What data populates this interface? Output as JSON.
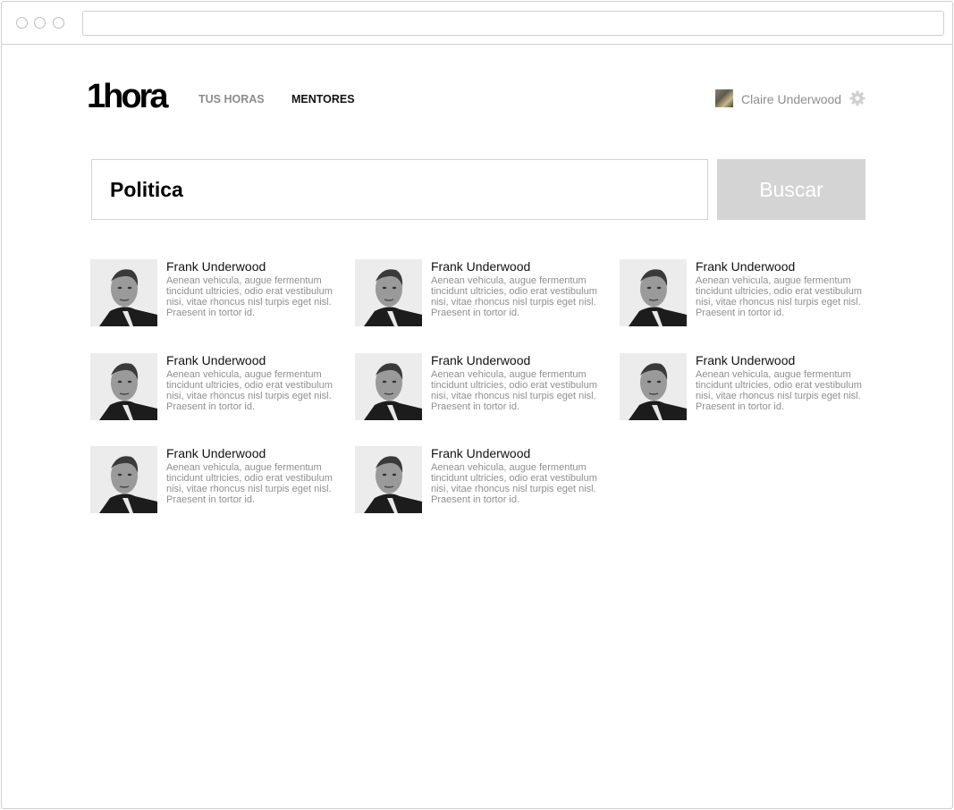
{
  "browser": {
    "url": ""
  },
  "header": {
    "logo": "1hora",
    "nav": [
      {
        "label": "TUS HORAS",
        "active": false
      },
      {
        "label": "MENTORES",
        "active": true
      }
    ],
    "user": {
      "name": "Claire Underwood"
    }
  },
  "search": {
    "value": "Politica",
    "button_label": "Buscar"
  },
  "mentors": [
    {
      "name": "Frank Underwood",
      "bio": "Aenean vehicula, augue fermentum tincidunt ultricies, odio erat vestibulum nisi, vitae rhoncus nisl turpis eget nisl. Praesent in tortor id."
    },
    {
      "name": "Frank Underwood",
      "bio": "Aenean vehicula, augue fermentum tincidunt ultricies, odio erat vestibulum nisi, vitae rhoncus nisl turpis eget nisl. Praesent in tortor id."
    },
    {
      "name": "Frank Underwood",
      "bio": "Aenean vehicula, augue fermentum tincidunt ultricies, odio erat vestibulum nisi, vitae rhoncus nisl turpis eget nisl. Praesent in tortor id."
    },
    {
      "name": "Frank Underwood",
      "bio": "Aenean vehicula, augue fermentum tincidunt ultricies, odio erat vestibulum nisi, vitae rhoncus nisl turpis eget nisl. Praesent in tortor id."
    },
    {
      "name": "Frank Underwood",
      "bio": "Aenean vehicula, augue fermentum tincidunt ultricies, odio erat vestibulum nisi, vitae rhoncus nisl turpis eget nisl. Praesent in tortor id."
    },
    {
      "name": "Frank Underwood",
      "bio": "Aenean vehicula, augue fermentum tincidunt ultricies, odio erat vestibulum nisi, vitae rhoncus nisl turpis eget nisl. Praesent in tortor id."
    },
    {
      "name": "Frank Underwood",
      "bio": "Aenean vehicula, augue fermentum tincidunt ultricies, odio erat vestibulum nisi, vitae rhoncus nisl turpis eget nisl. Praesent in tortor id."
    },
    {
      "name": "Frank Underwood",
      "bio": "Aenean vehicula, augue fermentum tincidunt ultricies, odio erat vestibulum nisi, vitae rhoncus nisl turpis eget nisl. Praesent in tortor id."
    }
  ],
  "icons": {
    "settings": "gear-icon",
    "avatar": "user-avatar"
  },
  "colors": {
    "button_bg": "#d4d4d4",
    "nav_inactive": "#8c8c8c",
    "nav_active": "#111111"
  }
}
